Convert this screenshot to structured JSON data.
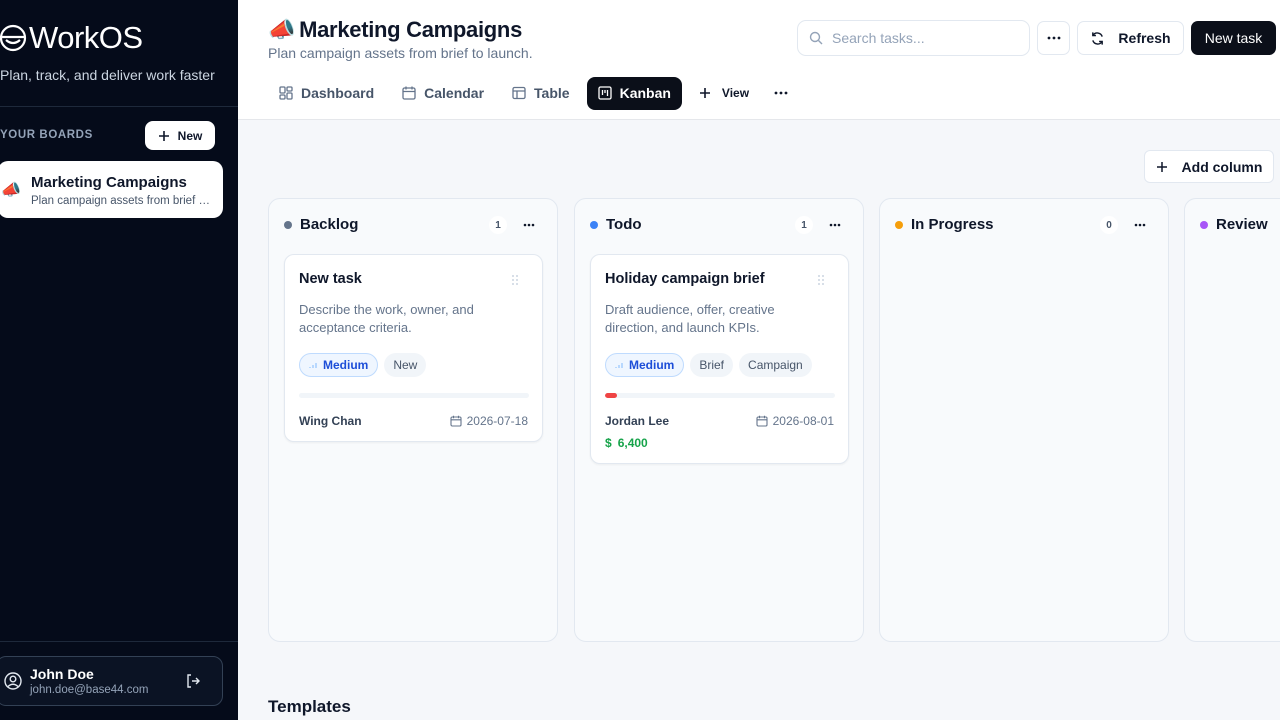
{
  "app": {
    "name": "WorkOS",
    "tagline": "Plan, track, and deliver work faster"
  },
  "sidebar": {
    "section_label": "YOUR BOARDS",
    "new_button": "New",
    "boards": [
      {
        "emoji": "📣",
        "title": "Marketing Campaigns",
        "subtitle": "Plan campaign assets from brief to launch."
      }
    ],
    "user": {
      "name": "John Doe",
      "email": "john.doe@base44.com"
    }
  },
  "header": {
    "emoji": "📣",
    "title": "Marketing Campaigns",
    "subtitle": "Plan campaign assets from brief to launch.",
    "search_placeholder": "Search tasks...",
    "refresh_label": "Refresh",
    "new_task_label": "New task"
  },
  "tabs": [
    {
      "label": "Dashboard",
      "icon": "dashboard-icon"
    },
    {
      "label": "Calendar",
      "icon": "calendar-icon"
    },
    {
      "label": "Table",
      "icon": "table-icon"
    },
    {
      "label": "Kanban",
      "icon": "kanban-icon",
      "active": true
    }
  ],
  "add_view_label": "View",
  "add_column_label": "Add column",
  "columns": [
    {
      "title": "Backlog",
      "count": "1",
      "color": "#64748b",
      "cards": [
        {
          "title": "New task",
          "description": "Describe the work, owner, and acceptance criteria.",
          "priority": "Medium",
          "tags": [
            "New"
          ],
          "progress": 0,
          "assignee": "Wing Chan",
          "due": "2026-07-18"
        }
      ]
    },
    {
      "title": "Todo",
      "count": "1",
      "color": "#3b82f6",
      "cards": [
        {
          "title": "Holiday campaign brief",
          "description": "Draft audience, offer, creative direction, and launch KPIs.",
          "priority": "Medium",
          "tags": [
            "Brief",
            "Campaign"
          ],
          "progress": 0.05,
          "assignee": "Jordan Lee",
          "due": "2026-08-01",
          "amount": "6,400"
        }
      ]
    },
    {
      "title": "In Progress",
      "count": "0",
      "color": "#f59e0b",
      "cards": []
    },
    {
      "title": "Review",
      "color": "#a855f7",
      "cards": []
    }
  ],
  "templates_heading": "Templates"
}
